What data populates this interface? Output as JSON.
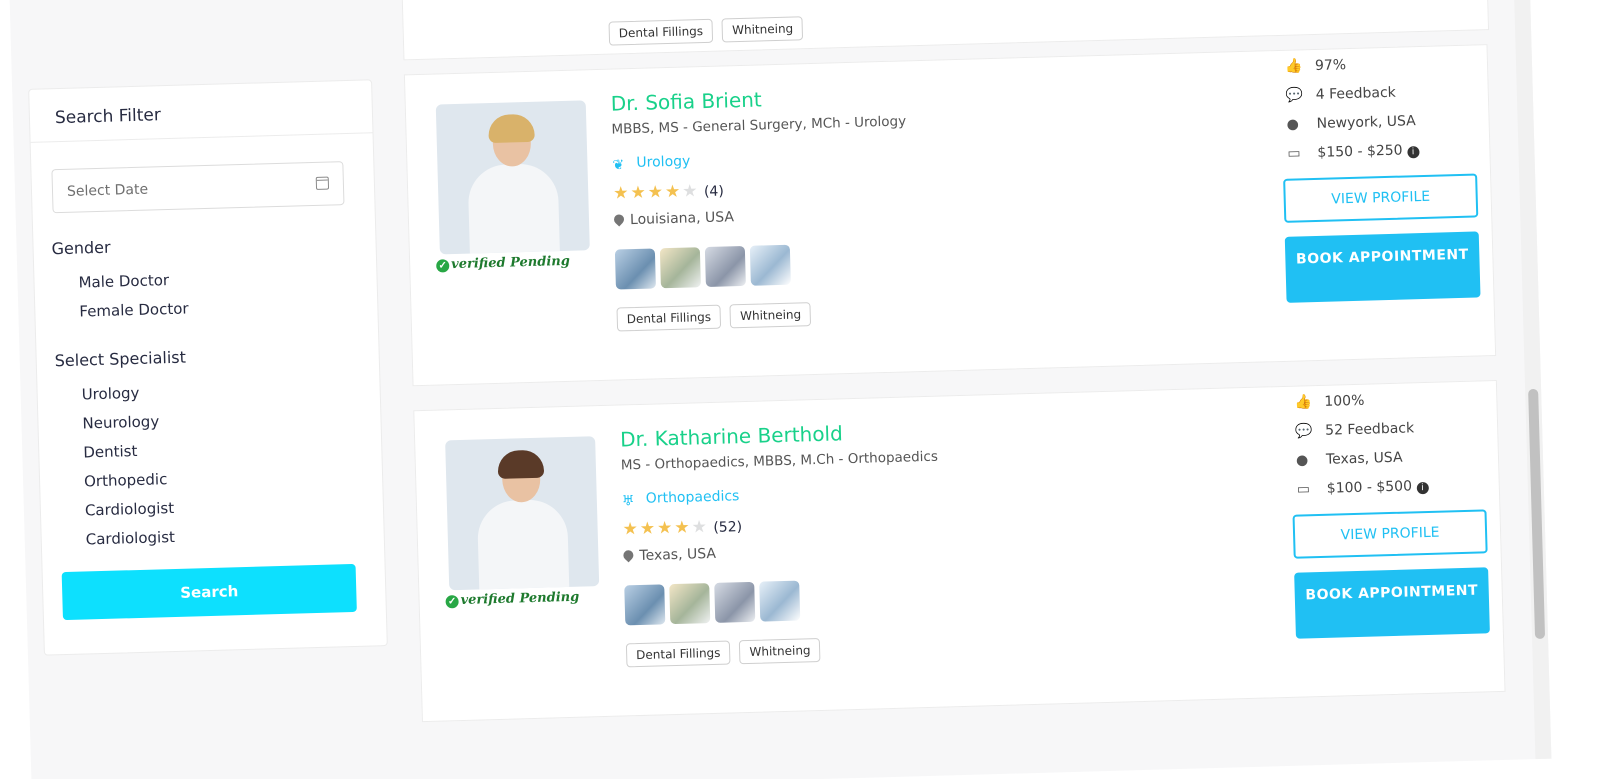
{
  "filter": {
    "title": "Search Filter",
    "date_placeholder": "Select Date",
    "gender_heading": "Gender",
    "gender_options": [
      "Male Doctor",
      "Female Doctor"
    ],
    "specialist_heading": "Select Specialist",
    "specialist_options": [
      "Urology",
      "Neurology",
      "Dentist",
      "Orthopedic",
      "Cardiologist",
      "Cardiologist"
    ],
    "search_label": "Search"
  },
  "top_card": {
    "tags": [
      "Dental Fillings",
      "Whitneing"
    ]
  },
  "doctors": [
    {
      "name": "Dr. Sofia Brient",
      "education": "MBBS, MS - General Surgery, MCh - Urology",
      "specialty": "Urology",
      "rating": 4,
      "rating_count": "(4)",
      "location": "Louisiana, USA",
      "verified": "verified Pending",
      "tags": [
        "Dental Fillings",
        "Whitneing"
      ],
      "likes": "97%",
      "feedback": "4 Feedback",
      "city": "Newyork, USA",
      "price": "$150 - $250",
      "view_label": "VIEW PROFILE",
      "book_label": "BOOK APPOINTMENT"
    },
    {
      "name": "Dr. Katharine Berthold",
      "education": "MS - Orthopaedics, MBBS, M.Ch - Orthopaedics",
      "specialty": "Orthopaedics",
      "rating": 4,
      "rating_count": "(52)",
      "location": "Texas, USA",
      "verified": "verified Pending",
      "tags": [
        "Dental Fillings",
        "Whitneing"
      ],
      "likes": "100%",
      "feedback": "52 Feedback",
      "city": "Texas, USA",
      "price": "$100 - $500",
      "view_label": "VIEW PROFILE",
      "book_label": "BOOK APPOINTMENT"
    }
  ],
  "icons": {
    "like": "thumbs-up-icon",
    "feedback": "comment-icon",
    "location": "map-marker-icon",
    "price": "money-bill-icon",
    "info": "info-icon",
    "verified": "check-circle-icon"
  },
  "colors": {
    "accent": "#20c0f3",
    "doctor_name": "#19d18a",
    "search_button": "#0de0fe",
    "star": "#f4c150",
    "verified": "#1e7a2e"
  }
}
